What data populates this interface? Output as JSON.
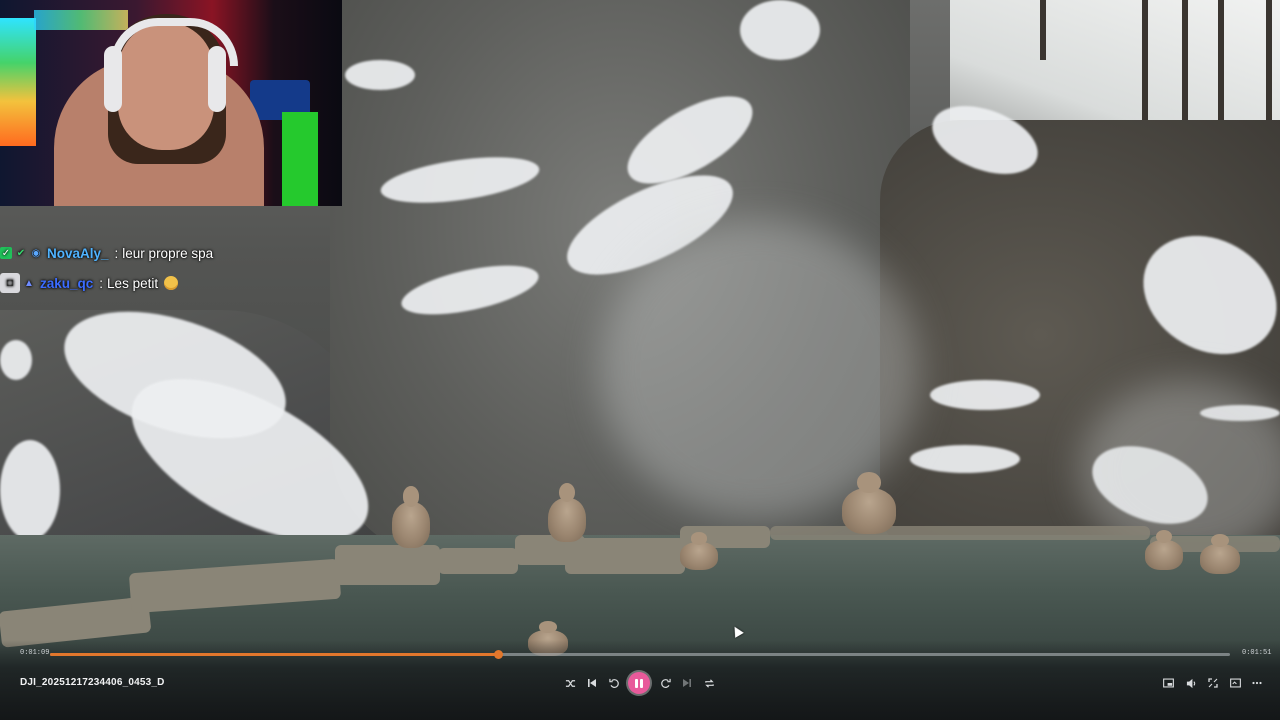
{
  "chat": {
    "messages": [
      {
        "username": "NovaAly_",
        "username_color": "#4fb3ff",
        "text": "leur propre spa",
        "badges": [
          "sub-badge",
          "check-badge",
          "verified-badge"
        ]
      },
      {
        "username": "zaku_qc",
        "username_color": "#3b6cff",
        "text": "Les petit",
        "badges": [
          "bot-badge",
          "prime-badge"
        ],
        "emoji": "pleading-face-emoji"
      }
    ]
  },
  "player": {
    "current_time": "0:01:09",
    "duration": "0:01:51",
    "progress": 0.38,
    "filename": "DJI_20251217234406_0453_D",
    "accent_color": "#e2772c",
    "play_button_color": "#e85a9b",
    "state": "playing"
  },
  "icons": {
    "shuffle": "shuffle-icon",
    "previous": "previous-icon",
    "rewind": "rewind-10-icon",
    "pause": "pause-icon",
    "forward": "forward-10-icon",
    "next": "next-icon",
    "repeat": "repeat-icon",
    "miniplayer": "miniplayer-icon",
    "volume": "volume-icon",
    "fullscreen": "fullscreen-icon",
    "cast": "cast-icon",
    "more": "more-icon"
  }
}
